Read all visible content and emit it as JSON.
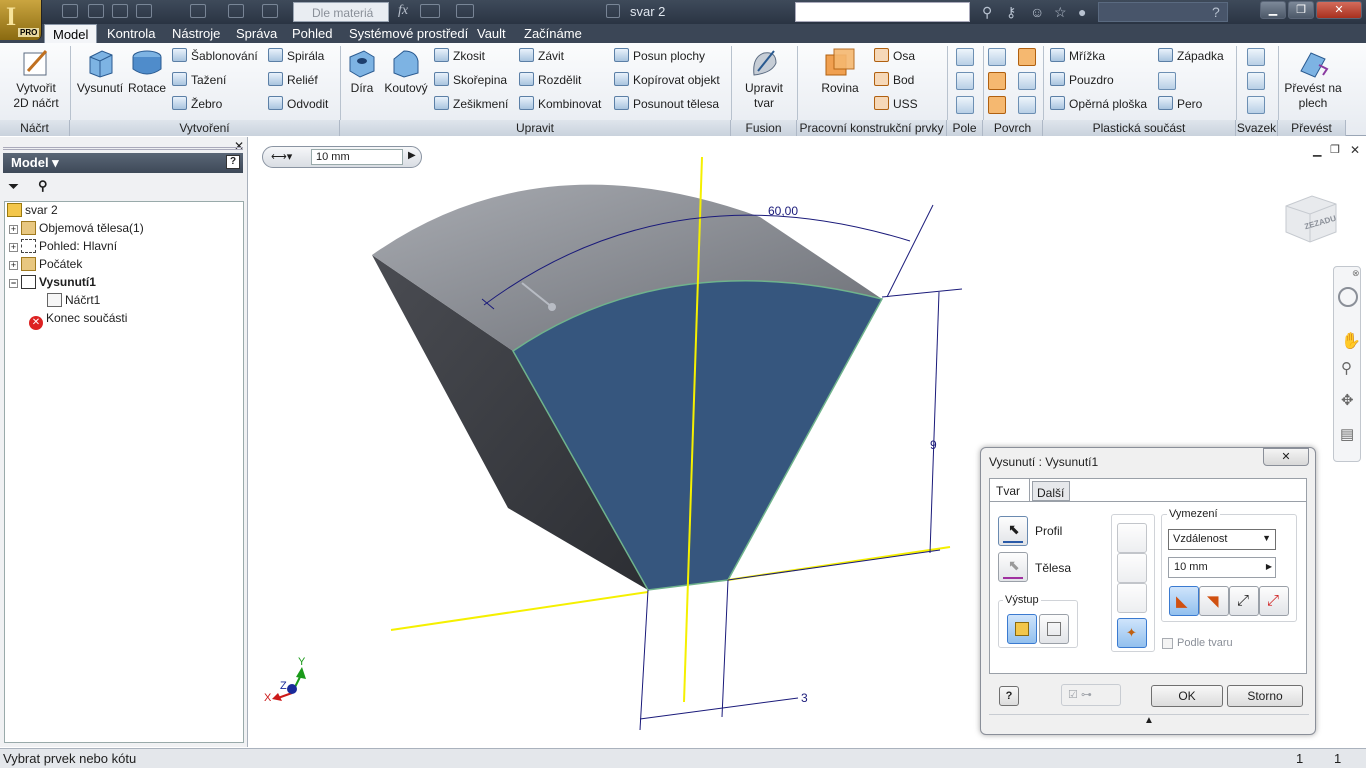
{
  "window": {
    "title": "svar 2",
    "quick_select": "Dle materiá",
    "fx_label": "fx"
  },
  "tabs": [
    "Model",
    "Kontrola",
    "Nástroje",
    "Správa",
    "Pohled",
    "Systémové prostředí",
    "Vault",
    "Začínáme"
  ],
  "ribbon": {
    "nacrt": {
      "create_sketch": "Vytvořit",
      "create_sketch_2": "2D náčrt",
      "panel": "Náčrt"
    },
    "vytvoreni": {
      "extrude": "Vysunutí",
      "revolve": "Rotace",
      "loft": "Šablonování",
      "sweep": "Tažení",
      "rib": "Žebro",
      "coil": "Spirála",
      "emboss": "Reliéf",
      "derive": "Odvodit",
      "panel": "Vytvoření"
    },
    "upravit": {
      "hole": "Díra",
      "fillet": "Koutový",
      "draft": "Zkosit",
      "shell": "Skořepina",
      "chamfer": "Zešikmení",
      "thread": "Závit",
      "split": "Rozdělit",
      "combine": "Kombinovat",
      "move_face": "Posun plochy",
      "copy_object": "Kopírovat objekt",
      "move_bodies": "Posunout tělesa",
      "panel": "Upravit"
    },
    "fusion": {
      "edit_form": "Upravit",
      "edit_form_2": "tvar",
      "panel": "Fusion"
    },
    "work": {
      "plane": "Rovina",
      "axis": "Osa",
      "point": "Bod",
      "ucs": "USS",
      "panel": "Pracovní konstrukční prvky"
    },
    "pole": {
      "panel": "Pole"
    },
    "povrch": {
      "panel": "Povrch"
    },
    "plastic": {
      "grill": "Mřížka",
      "boss": "Pouzdro",
      "rest": "Opěrná ploška",
      "snap": "Západka",
      "lip": "Pero",
      "panel": "Plastická součást"
    },
    "svazek": {
      "panel": "Svazek"
    },
    "prevest": {
      "convert": "Převést na",
      "convert_2": "plech",
      "panel": "Převést"
    }
  },
  "browser": {
    "header": "Model",
    "items": [
      "svar 2",
      "Objemová tělesa(1)",
      "Pohled: Hlavní",
      "Počátek",
      "Vysunutí1",
      "Náčrt1",
      "Konec součásti"
    ]
  },
  "viewport": {
    "mini_value": "10 mm",
    "angle_dim": "60,00",
    "height_dim": "9",
    "width_dim": "3",
    "viewcube_face": "ZEZADU",
    "triad": {
      "x": "X",
      "y": "Y",
      "z": "Z"
    }
  },
  "dialog": {
    "title": "Vysunutí : Vysunutí1",
    "tab_shape": "Tvar",
    "tab_more": "Další",
    "profile": "Profil",
    "solids": "Tělesa",
    "output": "Výstup",
    "extents": "Vymezení",
    "extent_type": "Vzdálenost",
    "distance": "10 mm",
    "match_shape": "Podle tvaru",
    "ok": "OK",
    "cancel": "Storno",
    "help": "?"
  },
  "status": {
    "text": "Vybrat prvek nebo kótu",
    "n1": "1",
    "n2": "1"
  },
  "colors": {
    "face_blue": "#36567e",
    "body_top": "#8c8f96",
    "body_side": "#3b3d42",
    "axis_yellow": "#f5f000",
    "dim_blue": "#1a1a7a"
  }
}
